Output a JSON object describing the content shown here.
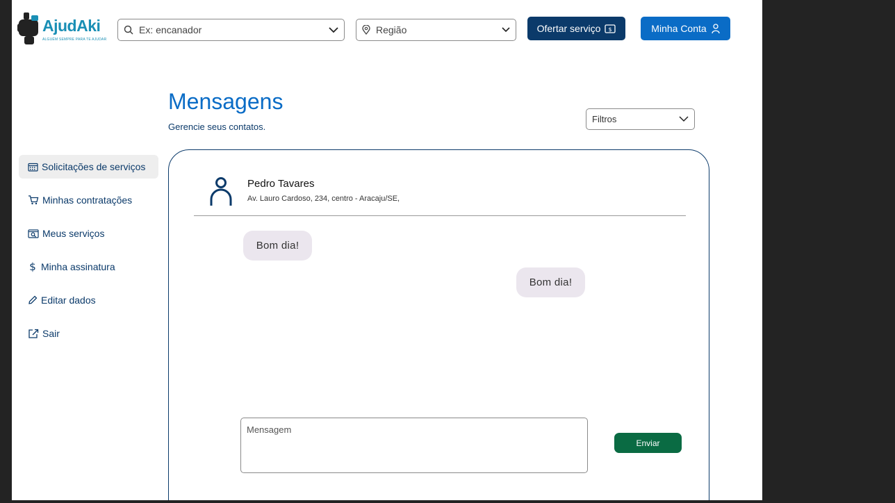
{
  "header": {
    "logo_text": "AjudAki",
    "logo_tagline": "ALGUÉM SEMPRE PARA TE AJUDAR",
    "search": {
      "placeholder": "Ex: encanador"
    },
    "region": {
      "placeholder": "Região"
    },
    "offer_button": "Ofertar serviço",
    "account_button": "Minha Conta"
  },
  "page": {
    "title": "Mensagens",
    "subtitle": "Gerencie seus contatos.",
    "filters_label": "Filtros"
  },
  "sidebar": {
    "items": [
      {
        "label": "Solicitações de serviços",
        "icon": "calendar-icon",
        "active": true
      },
      {
        "label": "Minhas contratações",
        "icon": "cart-icon",
        "active": false
      },
      {
        "label": "Meus serviços",
        "icon": "search-window-icon",
        "active": false
      },
      {
        "label": "Minha assinatura",
        "icon": "dollar-icon",
        "active": false
      },
      {
        "label": "Editar dados",
        "icon": "pencil-icon",
        "active": false
      },
      {
        "label": "Sair",
        "icon": "external-link-icon",
        "active": false
      }
    ]
  },
  "chat": {
    "contact_name": "Pedro Tavares",
    "contact_address": "Av. Lauro Cardoso, 234, centro - Aracaju/SE,",
    "messages": [
      {
        "text": "Bom dia!",
        "side": "left"
      },
      {
        "text": "Bom dia!",
        "side": "right"
      }
    ],
    "input_placeholder": "Mensagem",
    "send_label": "Enviar"
  },
  "colors": {
    "primary": "#0a6cc6",
    "dark_navy": "#0b3a6a",
    "send_green": "#0a6b43",
    "bubble": "#ebe6ee",
    "logo": "#1a8fb5"
  }
}
